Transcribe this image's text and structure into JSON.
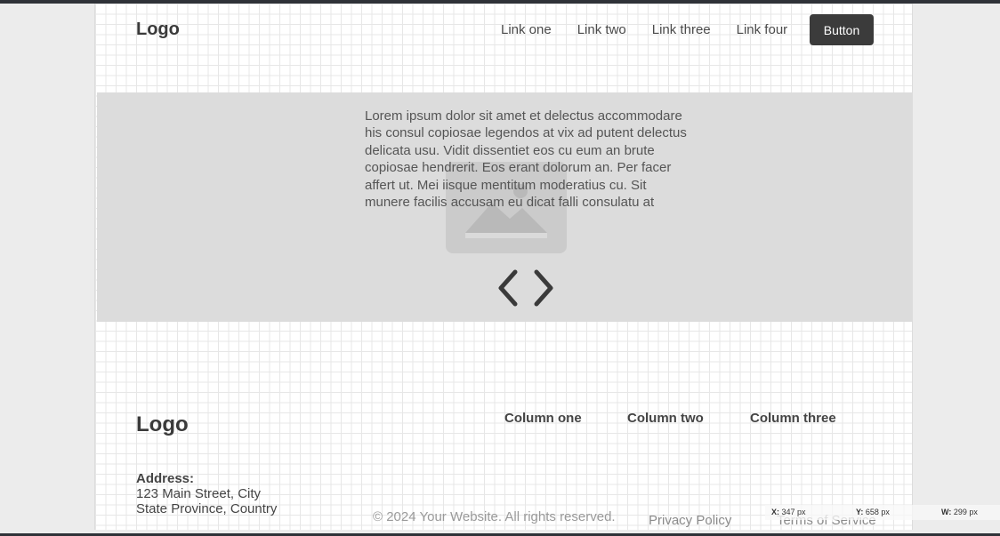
{
  "nav": {
    "logo": "Logo",
    "links": [
      "Link one",
      "Link two",
      "Link three",
      "Link four"
    ],
    "button": "Button"
  },
  "hero": {
    "text": "Lorem ipsum dolor sit amet et delectus accommodare his consul copiosae legendos at vix ad putent delectus delicata usu. Vidit dissentiet eos cu eum an brute copiosae hendrerit. Eos erant dolorum an. Per facer affert ut. Mei iisque mentitum moderatius cu. Sit munere facilis accusam eu dicat falli consulatu at",
    "icons": {
      "image": "image-placeholder-icon",
      "prev": "chevron-left-icon",
      "next": "chevron-right-icon"
    }
  },
  "footer": {
    "logo": "Logo",
    "columns": [
      "Column one",
      "Column two",
      "Column three"
    ],
    "address_label": "Address:",
    "address_line1": "123 Main Street, City",
    "address_line2": "State Province, Country",
    "copyright": "© 2024 Your Website. All rights reserved.",
    "privacy": "Privacy Policy",
    "terms": "Terms of Service"
  },
  "inspector": {
    "x_label": "X:",
    "x_value": "347 px",
    "y_label": "Y:",
    "y_value": "658 px",
    "w_label": "W:",
    "w_value": "299 px"
  },
  "colors": {
    "accent_button": "#3b3b3b",
    "hero_bg": "#dcdcdc",
    "frame": "#2f3238"
  }
}
